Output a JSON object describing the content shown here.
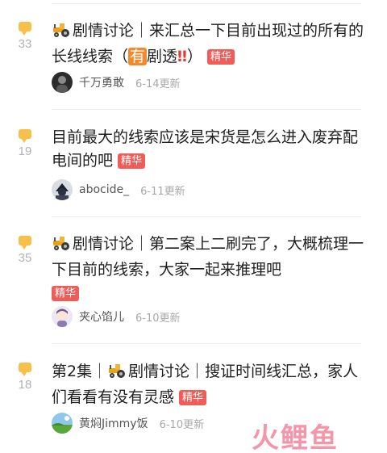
{
  "posts": [
    {
      "count": "33",
      "title_parts": {
        "a": "剧情讨论｜来汇总一下目前出现过的所有的长线线索（",
        "hl": "有",
        "b": "剧透",
        "c": "）"
      },
      "badge": "精华",
      "author": "千万勇敢",
      "time": "6-14更新"
    },
    {
      "count": "19",
      "title": "目前最大的线索应该是宋货是怎么进入废弃配电间的吧",
      "badge": "精华",
      "author": "abocide_",
      "time": "6-11更新"
    },
    {
      "count": "35",
      "title": "剧情讨论｜第二案上二刷完了，大概梳理一下目前的线索，大家一起来推理吧",
      "badge": "精华",
      "author": "夹心馅儿",
      "time": "6-10更新"
    },
    {
      "count": "18",
      "title_parts": {
        "a": "第2集｜",
        "b": "剧情讨论｜搜证时间线汇总，家人们看看有没有灵感"
      },
      "badge": "精华",
      "author": "黄焖Jimmy饭",
      "time": "6-10更新"
    }
  ],
  "watermark": "火鲤鱼",
  "colors": {
    "badge": "#f05d58",
    "comment_icon": "#f6c04a",
    "highlight": "#f28a2b",
    "watermark": "#e94064"
  },
  "icons": [
    "comment-bubble-icon",
    "tractor-emoji-icon",
    "double-exclamation-icon"
  ]
}
